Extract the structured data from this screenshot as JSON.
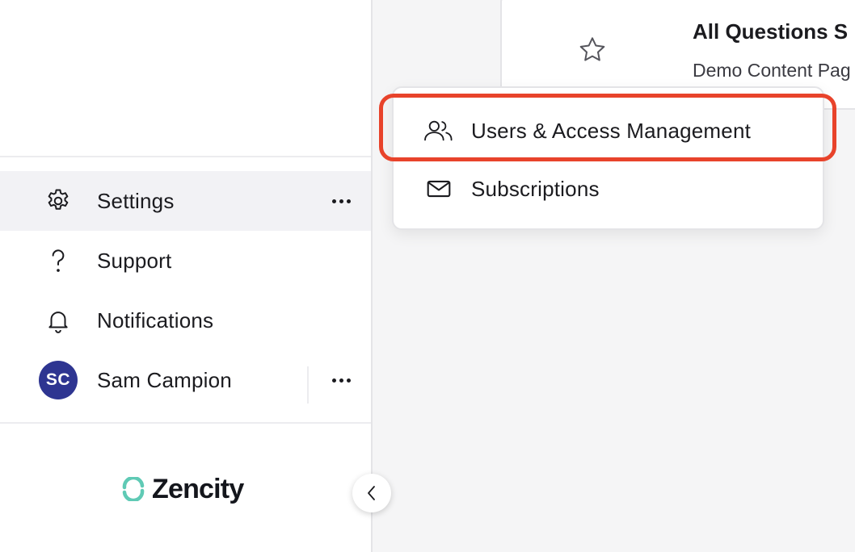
{
  "sidebar": {
    "items": [
      {
        "label": "Settings",
        "icon": "gear-icon",
        "active": true
      },
      {
        "label": "Support",
        "icon": "question-icon"
      },
      {
        "label": "Notifications",
        "icon": "bell-icon"
      }
    ],
    "user": {
      "initials": "SC",
      "name": "Sam Campion"
    },
    "logo": "Zencity"
  },
  "card": {
    "title": "All Questions S",
    "subtitle": "Demo Content Pag"
  },
  "dropdown": {
    "items": [
      {
        "label": "Users & Access Management",
        "icon": "users-icon",
        "highlighted": true
      },
      {
        "label": "Subscriptions",
        "icon": "envelope-icon"
      }
    ]
  },
  "colors": {
    "highlight": "#e8432b",
    "avatar": "#2e3591",
    "brand": "#5fcab5"
  }
}
